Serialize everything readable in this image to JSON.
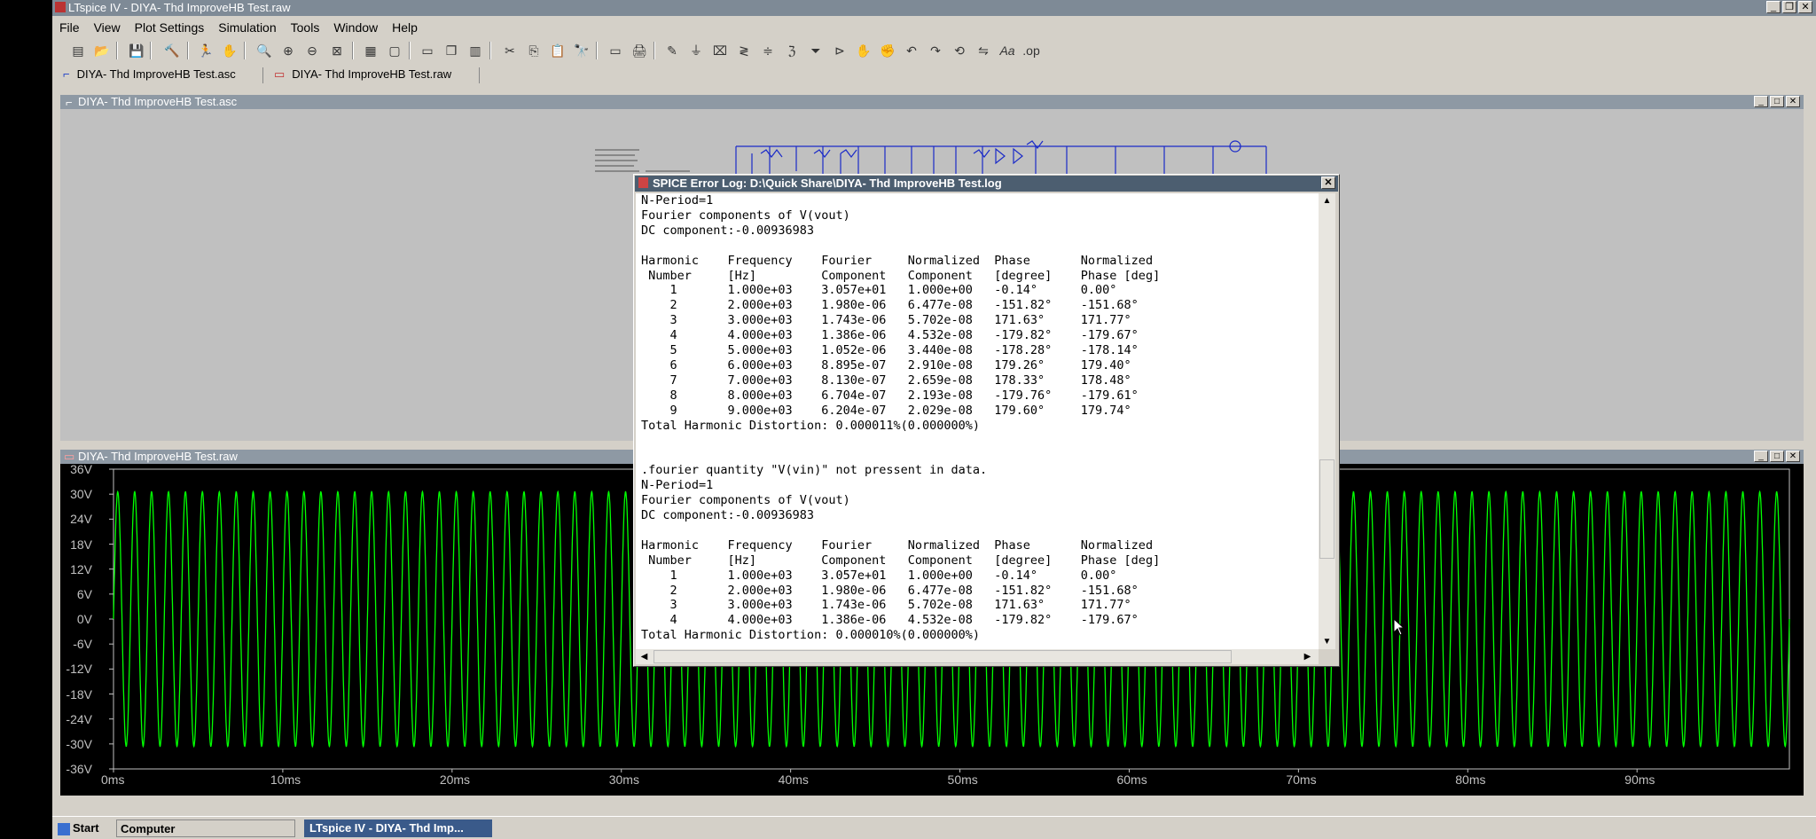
{
  "app": {
    "title": "LTspice IV - DIYA- Thd ImproveHB Test.raw",
    "menu": [
      "File",
      "View",
      "Plot Settings",
      "Simulation",
      "Tools",
      "Window",
      "Help"
    ]
  },
  "doc_tabs": [
    {
      "label": "DIYA- Thd ImproveHB Test.asc",
      "icon": "schematic-icon"
    },
    {
      "label": "DIYA- Thd ImproveHB Test.raw",
      "icon": "waveform-icon"
    }
  ],
  "schematic_window": {
    "title": "DIYA- Thd ImproveHB Test.asc"
  },
  "plot_window": {
    "title": "DIYA- Thd ImproveHB Test.raw"
  },
  "chart_data": {
    "type": "line",
    "title": "",
    "xlabel": "",
    "ylabel": "",
    "x_ticks": [
      "0ms",
      "10ms",
      "20ms",
      "30ms",
      "40ms",
      "50ms",
      "60ms",
      "70ms",
      "80ms",
      "90ms"
    ],
    "y_ticks": [
      "36V",
      "30V",
      "24V",
      "18V",
      "12V",
      "6V",
      "0V",
      "-6V",
      "-12V",
      "-18V",
      "-24V",
      "-30V",
      "-36V"
    ],
    "xlim": [
      0,
      99
    ],
    "ylim": [
      -36,
      36
    ],
    "grid": false,
    "series": [
      {
        "color": "#00ff00",
        "waveform": "sine",
        "amplitude": 30.57,
        "frequency_hz": 1000
      }
    ]
  },
  "error_log": {
    "title": "SPICE Error Log: D:\\Quick Share\\DIYA- Thd ImproveHB Test.log",
    "lines": [
      "N-Period=1",
      "Fourier components of V(vout)",
      "DC component:-0.00936983",
      "",
      "Harmonic    Frequency    Fourier     Normalized  Phase       Normalized",
      " Number     [Hz]         Component   Component   [degree]    Phase [deg]",
      "    1       1.000e+03    3.057e+01   1.000e+00   -0.14°      0.00°",
      "    2       2.000e+03    1.980e-06   6.477e-08   -151.82°    -151.68°",
      "    3       3.000e+03    1.743e-06   5.702e-08   171.63°     171.77°",
      "    4       4.000e+03    1.386e-06   4.532e-08   -179.82°    -179.67°",
      "    5       5.000e+03    1.052e-06   3.440e-08   -178.28°    -178.14°",
      "    6       6.000e+03    8.895e-07   2.910e-08   179.26°     179.40°",
      "    7       7.000e+03    8.130e-07   2.659e-08   178.33°     178.48°",
      "    8       8.000e+03    6.704e-07   2.193e-08   -179.76°    -179.61°",
      "    9       9.000e+03    6.204e-07   2.029e-08   179.60°     179.74°",
      "Total Harmonic Distortion: 0.000011%(0.000000%)",
      "",
      "",
      ".fourier quantity \"V(vin)\" not pressent in data.",
      "N-Period=1",
      "Fourier components of V(vout)",
      "DC component:-0.00936983",
      "",
      "Harmonic    Frequency    Fourier     Normalized  Phase       Normalized",
      " Number     [Hz]         Component   Component   [degree]    Phase [deg]",
      "    1       1.000e+03    3.057e+01   1.000e+00   -0.14°      0.00°",
      "    2       2.000e+03    1.980e-06   6.477e-08   -151.82°    -151.68°",
      "    3       3.000e+03    1.743e-06   5.702e-08   171.63°     171.77°",
      "    4       4.000e+03    1.386e-06   4.532e-08   -179.82°    -179.67°",
      "Total Harmonic Distortion: 0.000010%(0.000000%)"
    ]
  },
  "taskbar": {
    "start": "Start",
    "computer": "Computer",
    "active_task": "LTspice IV - DIYA- Thd Imp..."
  },
  "colors": {
    "plot_background": "#000000",
    "trace": "#00ff00",
    "titlebar": "#7e8a96",
    "dialog_titlebar": "#4c5e70"
  }
}
